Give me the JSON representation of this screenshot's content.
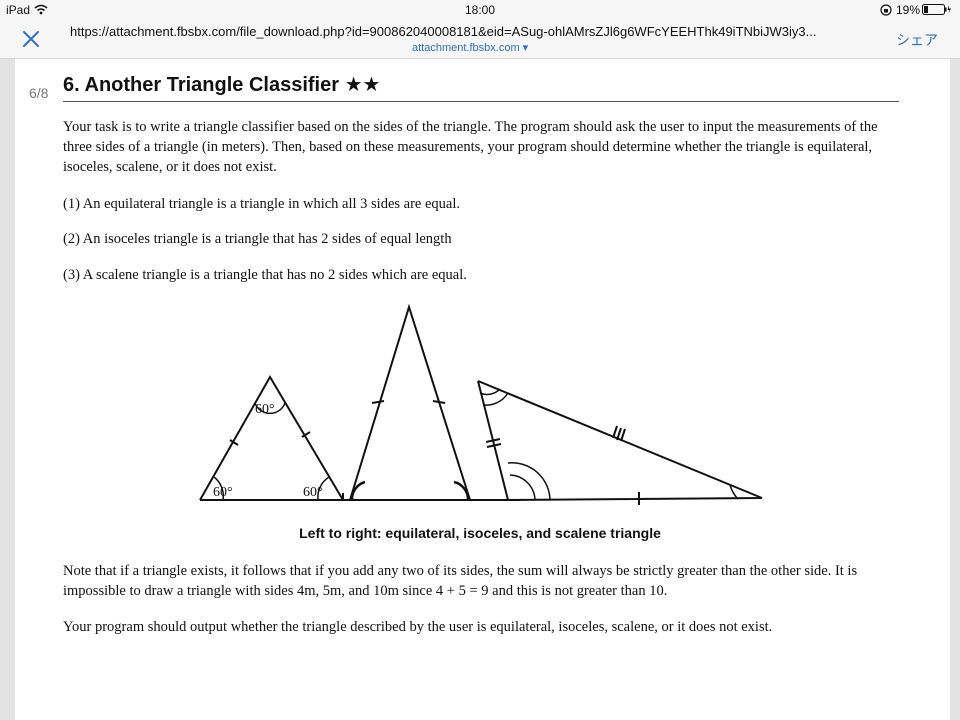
{
  "status_bar": {
    "device": "iPad",
    "time": "18:00",
    "battery": "19%"
  },
  "nav_bar": {
    "url": "https://attachment.fbsbx.com/file_download.php?id=900862040008181&eid=ASug-ohlAMrsZJl6g6WFcYEEHThk49iTNbiJW3iy3...",
    "domain": "attachment.fbsbx.com ▾",
    "share_label": "シェア"
  },
  "document": {
    "page_counter": "6/8",
    "title": "6. Another Triangle Classifier ★★",
    "intro": "Your task is to write a triangle classifier based on the sides of the triangle. The program should ask the user to input the measurements of the three sides of a triangle (in meters). Then, based on these measurements, your program should determine whether the triangle is equilateral, isoceles, scalene, or it does not exist.",
    "definitions": [
      "(1) An equilateral triangle is a triangle in which all 3 sides are equal.",
      "(2) An isoceles triangle is a triangle that has 2 sides of equal length",
      "(3) A scalene triangle is a triangle that has no 2 sides which are equal."
    ],
    "figure": {
      "angle_top": "60°",
      "angle_left": "60°",
      "angle_right": "60°",
      "caption": "Left to right: equilateral, isoceles, and scalene triangle"
    },
    "note": "Note that if a triangle exists, it follows that if you add any two of its sides, the sum will always be strictly greater than the other side. It is impossible to draw a triangle with sides 4m, 5m, and 10m since 4 + 5 = 9 and this is not greater than 10.",
    "output": "Your program should output whether the triangle described by the user is equilateral, isoceles, scalene, or it does not exist."
  },
  "colors": {
    "link_blue": "#2f6fc2",
    "chrome_gray": "#f6f6f6",
    "viewer_gray": "#e3e3e3"
  }
}
